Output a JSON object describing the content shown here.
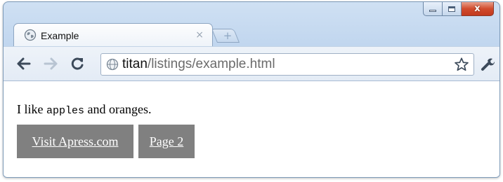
{
  "browser": {
    "tab_title": "Example",
    "tab_close": "×",
    "newtab_glyph": "+",
    "url_host": "titan",
    "url_path": "/listings/example.html",
    "icons": [
      "globe-icon",
      "back-icon",
      "forward-icon",
      "reload-icon",
      "star-icon",
      "wrench-icon",
      "minimize-icon",
      "maximize-icon",
      "close-icon"
    ]
  },
  "window_controls": {
    "close_glyph": "x"
  },
  "page": {
    "para_before": "I like ",
    "para_code": "apples",
    "para_after": " and oranges.",
    "links": [
      {
        "label": "Visit Apress.com"
      },
      {
        "label": "Page 2"
      }
    ],
    "link_bg_color": "#808080",
    "link_text_color": "#ffffff"
  }
}
